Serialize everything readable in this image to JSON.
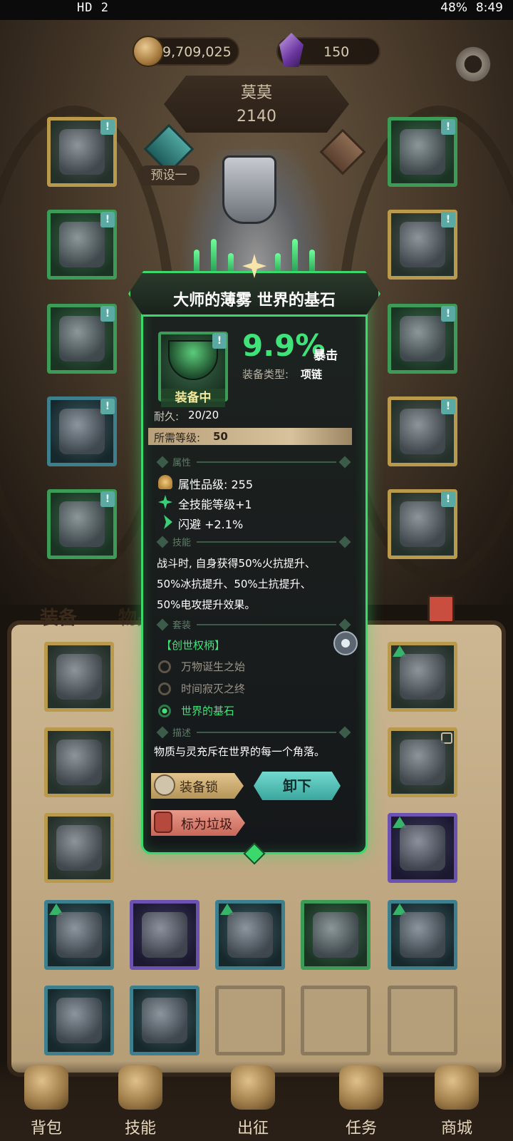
{
  "status_bar": {
    "left": "HD 2",
    "right": "48%",
    "time": "8:49"
  },
  "currency": {
    "gold": "9,709,025",
    "gems": "150"
  },
  "character": {
    "name": "莫莫",
    "power": "2140",
    "preset_label": "预设一"
  },
  "tabs": {
    "equip": "装备",
    "items": "物品"
  },
  "equip_slot_badge": "!",
  "item_popup": {
    "title": "大师的薄雾 世界的基石",
    "equipped_label": "装备中",
    "main_stat_value": "9.9%",
    "main_stat_name": "暴击",
    "type_label": "装备类型:",
    "type_value": "项链",
    "durability_label": "耐久:",
    "durability_value": "20/20",
    "required_level_label": "所需等级:",
    "required_level_value": "50",
    "sections": {
      "attributes": "属性",
      "skill": "技能",
      "set": "套装",
      "description": "描述"
    },
    "attributes": [
      "属性品级: 255",
      "全技能等级+1",
      "闪避 +2.1%"
    ],
    "skill_lines": [
      "战斗时, 自身获得50%火抗提升、",
      "50%冰抗提升、50%土抗提升、",
      "50%电攻提升效果。"
    ],
    "set_name": "【创世权柄】",
    "set_items": [
      {
        "name": "万物诞生之始",
        "active": false
      },
      {
        "name": "时间寂灭之终",
        "active": false
      },
      {
        "name": "世界的基石",
        "active": true
      }
    ],
    "description": "物质与灵充斥在世界的每一个角落。",
    "buttons": {
      "lock": "装备锁",
      "unequip": "卸下",
      "junk": "标为垃圾"
    }
  },
  "bottom_nav": [
    "背包",
    "技能",
    "出征",
    "任务",
    "商城"
  ],
  "colors": {
    "accent_green": "#3fe37a",
    "rarity_gold": "#b99a4c",
    "rarity_green": "#3d9b58",
    "rarity_teal": "#3d7f8c",
    "rarity_purple": "#6b51b0"
  }
}
